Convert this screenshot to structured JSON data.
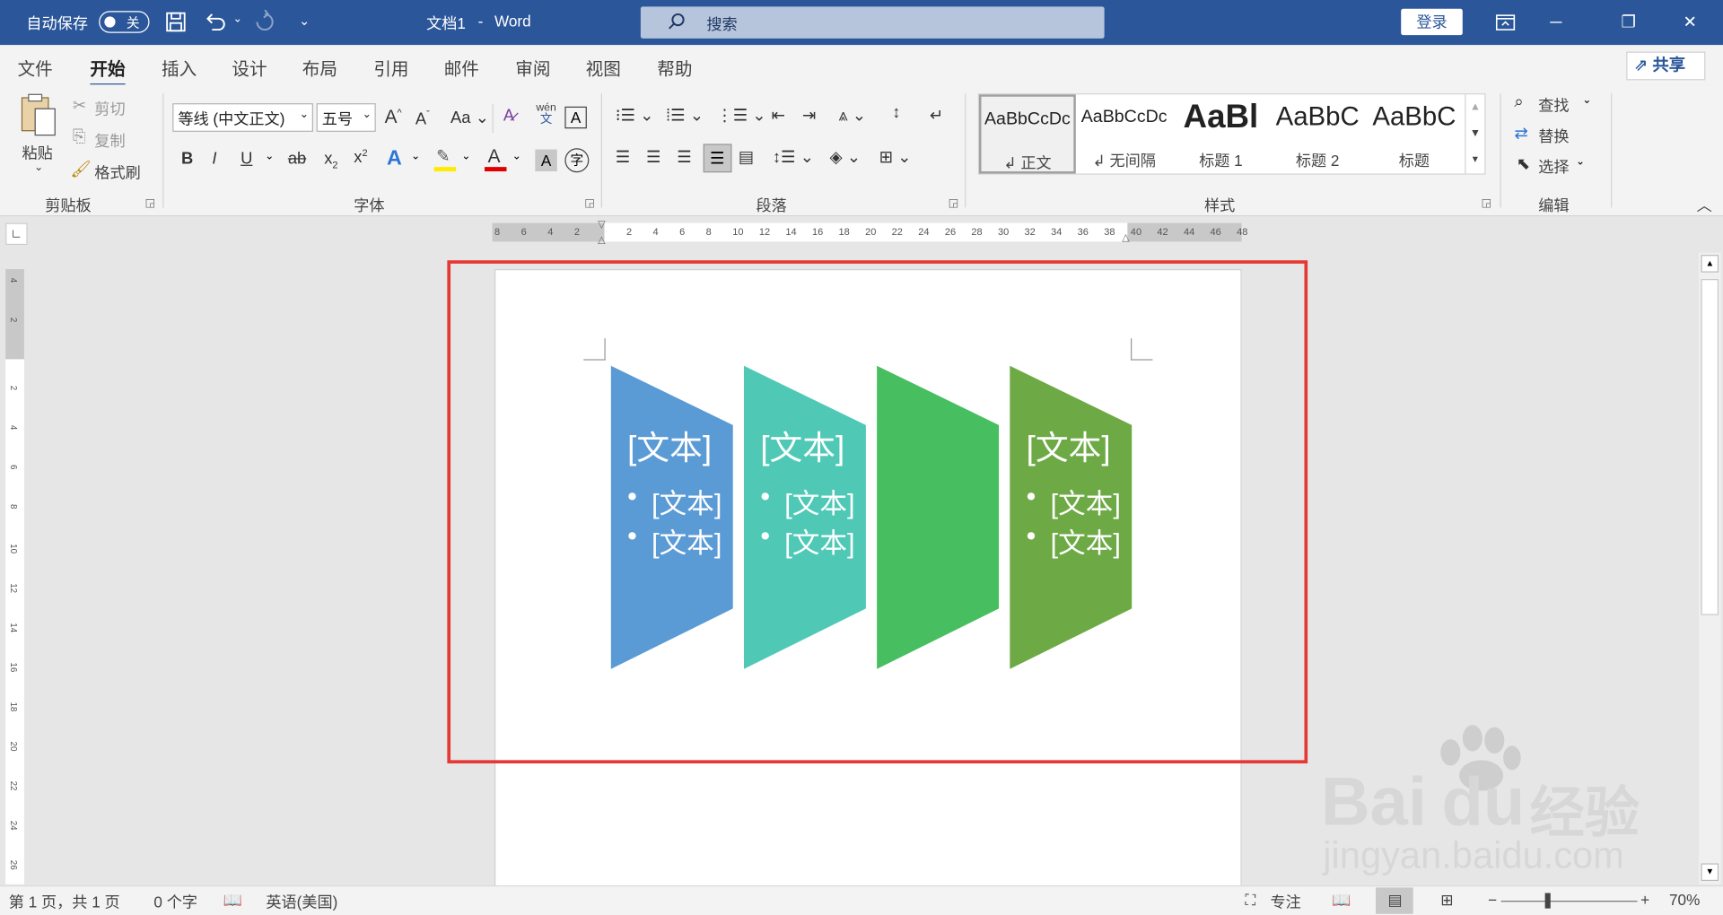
{
  "titlebar": {
    "autosave_label": "自动保存",
    "autosave_state": "关",
    "doc_title": "文档1",
    "separator": "-",
    "app_name": "Word",
    "search_placeholder": "搜索",
    "login_label": "登录"
  },
  "tabs": [
    "文件",
    "开始",
    "插入",
    "设计",
    "布局",
    "引用",
    "邮件",
    "审阅",
    "视图",
    "帮助"
  ],
  "active_tab": "开始",
  "share_label": "共享",
  "clipboard": {
    "paste_label": "粘贴",
    "cut_label": "剪切",
    "copy_label": "复制",
    "format_painter_label": "格式刷",
    "group_label": "剪贴板"
  },
  "font": {
    "font_name": "等线 (中文正文)",
    "font_size": "五号",
    "phonetic_top": "wén",
    "phonetic_bottom": "文",
    "group_label": "字体"
  },
  "paragraph": {
    "group_label": "段落"
  },
  "styles": {
    "items": [
      {
        "preview": "AaBbCcDc",
        "name": "正文"
      },
      {
        "preview": "AaBbCcDc",
        "name": "无间隔"
      },
      {
        "preview": "AaBl",
        "name": "标题 1"
      },
      {
        "preview": "AaBbC",
        "name": "标题 2"
      },
      {
        "preview": "AaBbC",
        "name": "标题"
      }
    ],
    "group_label": "样式"
  },
  "editing": {
    "find_label": "查找",
    "replace_label": "替换",
    "select_label": "选择",
    "group_label": "编辑"
  },
  "ruler_h": [
    "8",
    "6",
    "4",
    "2",
    "2",
    "4",
    "6",
    "8",
    "10",
    "12",
    "14",
    "16",
    "18",
    "20",
    "22",
    "24",
    "26",
    "28",
    "30",
    "32",
    "34",
    "36",
    "38",
    "40",
    "42",
    "44",
    "46",
    "48"
  ],
  "ruler_v": [
    "4",
    "2",
    "2",
    "4",
    "6",
    "8",
    "10",
    "12",
    "14",
    "16",
    "18",
    "20",
    "22",
    "24",
    "26"
  ],
  "smartart": {
    "shapes": [
      {
        "color": "#5b9bd5",
        "title": "[文本]",
        "bullets": [
          "[文本]",
          "[文本]"
        ]
      },
      {
        "color": "#4fc9b6",
        "title": "[文本]",
        "bullets": [
          "[文本]",
          "[文本]"
        ]
      },
      {
        "color": "#47be5f",
        "title": "",
        "bullets": []
      },
      {
        "color": "#6daa45",
        "title": "[文本]",
        "bullets": [
          "[文本]",
          "[文本]"
        ]
      }
    ]
  },
  "status": {
    "page_info": "第 1 页，共 1 页",
    "word_count": "0 个字",
    "language": "英语(美国)",
    "focus_label": "专注",
    "zoom_level": "70%"
  },
  "watermark": {
    "brand": "Bai",
    "brand2": "du",
    "cn": "经验",
    "url": "jingyan.baidu.com"
  },
  "colors": {
    "accent": "#2b579a",
    "highlight_box": "#e53935"
  }
}
